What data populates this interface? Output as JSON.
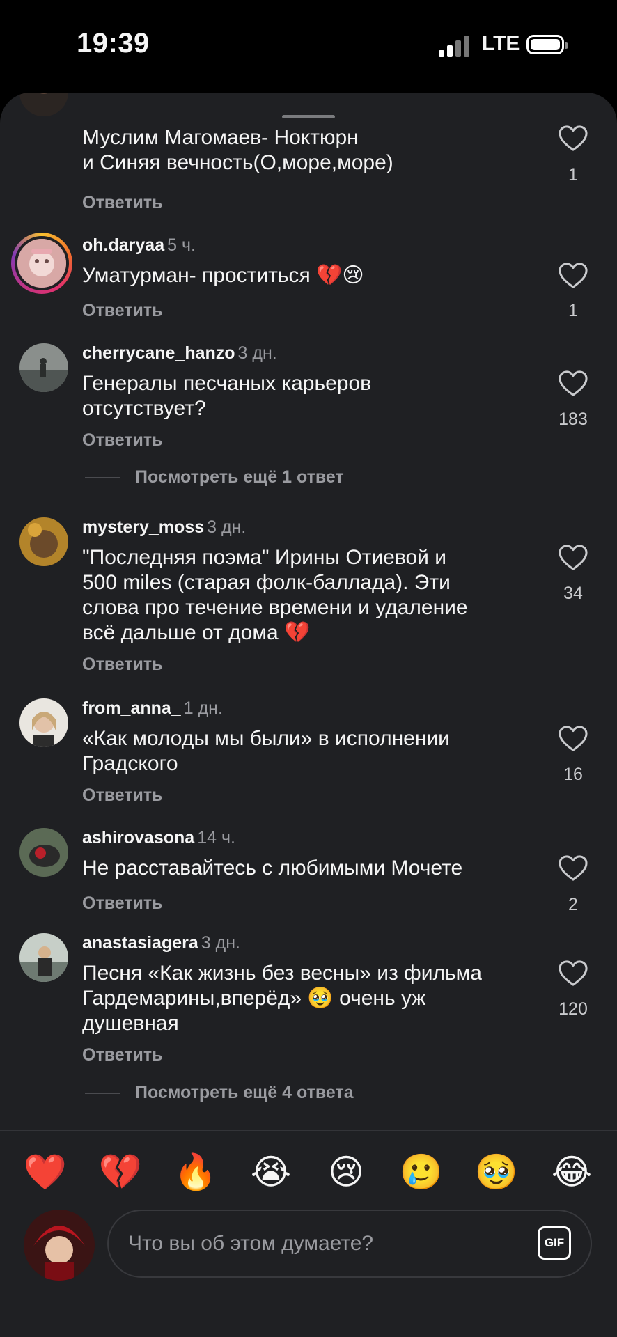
{
  "status_bar": {
    "time": "19:39",
    "network": "LTE"
  },
  "comments": [
    {
      "text_lines": [
        "Муслим Магомаев- Ноктюрн",
        "и Синяя вечность(О,море,море)"
      ],
      "likes": "1",
      "reply": "Ответить"
    },
    {
      "username": "oh.daryaa",
      "ago": "5 ч.",
      "text": "Уматурман- проститься 💔😢",
      "likes": "1",
      "reply": "Ответить"
    },
    {
      "username": "cherrycane_hanzo",
      "ago": "3 дн.",
      "text_lines": [
        "Генералы песчаных карьеров",
        "отсутствует?"
      ],
      "likes": "183",
      "reply": "Ответить",
      "more": "Посмотреть ещё 1 ответ"
    },
    {
      "username": "mystery_moss",
      "ago": "3 дн.",
      "text_lines": [
        "\"Последняя поэма\" Ирины Отиевой и",
        "500 miles (старая фолк-баллада). Эти",
        "слова про течение времени и удаление",
        "всё дальше от дома 💔"
      ],
      "likes": "34",
      "reply": "Ответить"
    },
    {
      "username": "from_anna_",
      "ago": "1 дн.",
      "text_lines": [
        "«Как молоды мы были» в исполнении",
        "Градского"
      ],
      "likes": "16",
      "reply": "Ответить"
    },
    {
      "username": "ashirovasona",
      "ago": "14 ч.",
      "text": "Не расставайтесь с любимыми Мочете",
      "likes": "2",
      "reply": "Ответить"
    },
    {
      "username": "anastasiagera",
      "ago": "3 дн.",
      "text_lines": [
        "Песня «Как жизнь без весны» из фильма",
        "Гардемарины,вперёд» 🥹 очень уж",
        "душевная"
      ],
      "likes": "120",
      "reply": "Ответить",
      "more": "Посмотреть ещё 4 ответа"
    }
  ],
  "emoji_bar": [
    "❤️",
    "💔",
    "🔥",
    "😭",
    "😢",
    "🥲",
    "🥹",
    "😂"
  ],
  "composer": {
    "placeholder": "Что вы об этом думаете?",
    "gif_label": "GIF"
  },
  "colors": {
    "sheet_bg": "#1f2023",
    "muted_text": "#9a9ba0",
    "story_ring": "#e1306c"
  }
}
